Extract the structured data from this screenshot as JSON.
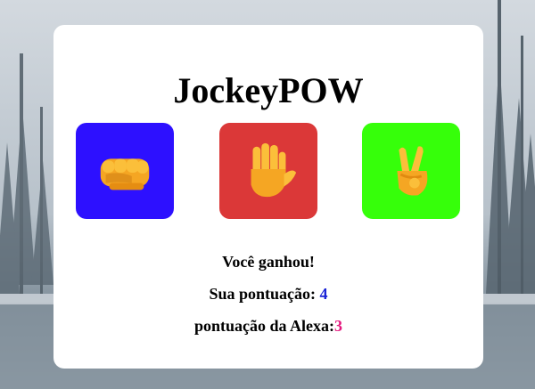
{
  "app": {
    "title": "JockeyPOW"
  },
  "choices": [
    {
      "id": "rock",
      "icon": "fist-icon",
      "color": "#2d10ff"
    },
    {
      "id": "paper",
      "icon": "raised-hand-icon",
      "color": "#db3838"
    },
    {
      "id": "scissors",
      "icon": "victory-hand-icon",
      "color": "#36ff0a"
    }
  ],
  "status": {
    "result": "Você ganhou!",
    "user_score_label": "Sua pontuação: ",
    "user_score": "4",
    "alexa_score_label": "pontuação da Alexa:",
    "alexa_score": "3"
  },
  "colors": {
    "user_score": "#1a23d6",
    "alexa_score": "#e5177e",
    "card": "#ffffff"
  }
}
